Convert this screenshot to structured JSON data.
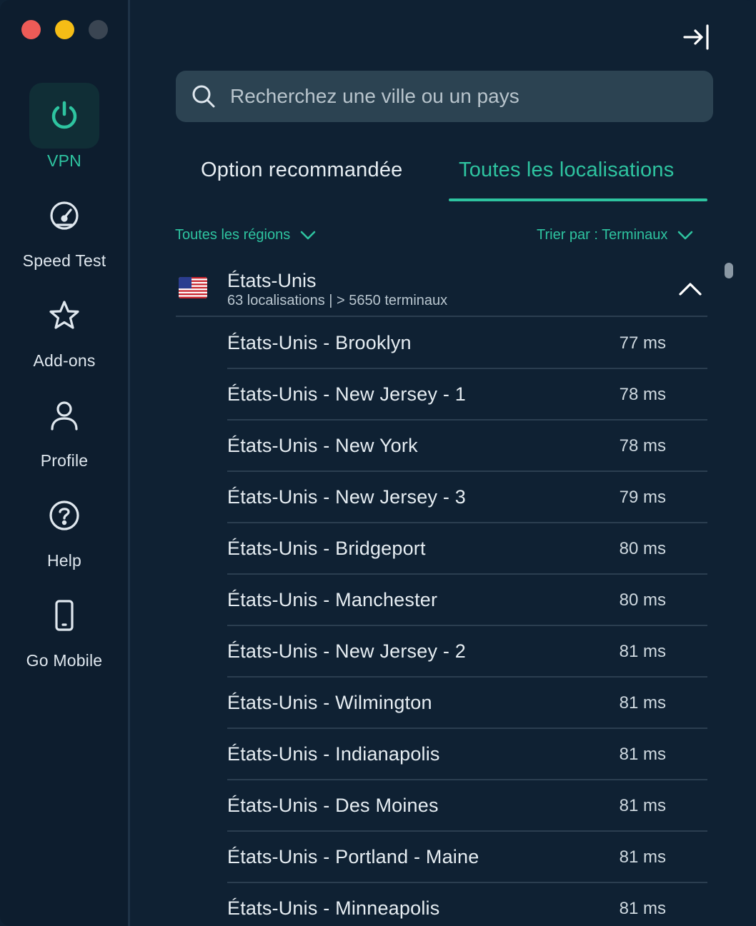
{
  "sidebar": {
    "items": [
      {
        "label": "VPN",
        "icon": "power-icon",
        "active": true
      },
      {
        "label": "Speed Test",
        "icon": "speedometer-icon"
      },
      {
        "label": "Add-ons",
        "icon": "star-icon"
      },
      {
        "label": "Profile",
        "icon": "person-icon"
      },
      {
        "label": "Help",
        "icon": "help-icon"
      },
      {
        "label": "Go Mobile",
        "icon": "mobile-icon"
      }
    ]
  },
  "search": {
    "placeholder": "Recherchez une ville ou un pays"
  },
  "tabs": [
    {
      "label": "Option recommandée"
    },
    {
      "label": "Toutes les localisations",
      "active": true
    }
  ],
  "filters": {
    "region": "Toutes les régions",
    "sort": "Trier par : Terminaux"
  },
  "country": {
    "name": "États-Unis",
    "subtitle": "63 localisations | > 5650 terminaux"
  },
  "locations": [
    {
      "city": "États-Unis - Brooklyn",
      "ms": "77 ms"
    },
    {
      "city": "États-Unis - New Jersey - 1",
      "ms": "78 ms"
    },
    {
      "city": "États-Unis - New York",
      "ms": "78 ms"
    },
    {
      "city": "États-Unis - New Jersey - 3",
      "ms": "79 ms"
    },
    {
      "city": "États-Unis - Bridgeport",
      "ms": "80 ms"
    },
    {
      "city": "États-Unis - Manchester",
      "ms": "80 ms"
    },
    {
      "city": "États-Unis - New Jersey - 2",
      "ms": "81 ms"
    },
    {
      "city": "États-Unis - Wilmington",
      "ms": "81 ms"
    },
    {
      "city": "États-Unis - Indianapolis",
      "ms": "81 ms"
    },
    {
      "city": "États-Unis - Des Moines",
      "ms": "81 ms"
    },
    {
      "city": "États-Unis - Portland - Maine",
      "ms": "81 ms"
    },
    {
      "city": "États-Unis - Minneapolis",
      "ms": "81 ms"
    }
  ],
  "colors": {
    "accent": "#2ec4a0",
    "background": "#0f2133",
    "sidebar": "#0d1d2e",
    "search_bg": "#2c4352"
  }
}
